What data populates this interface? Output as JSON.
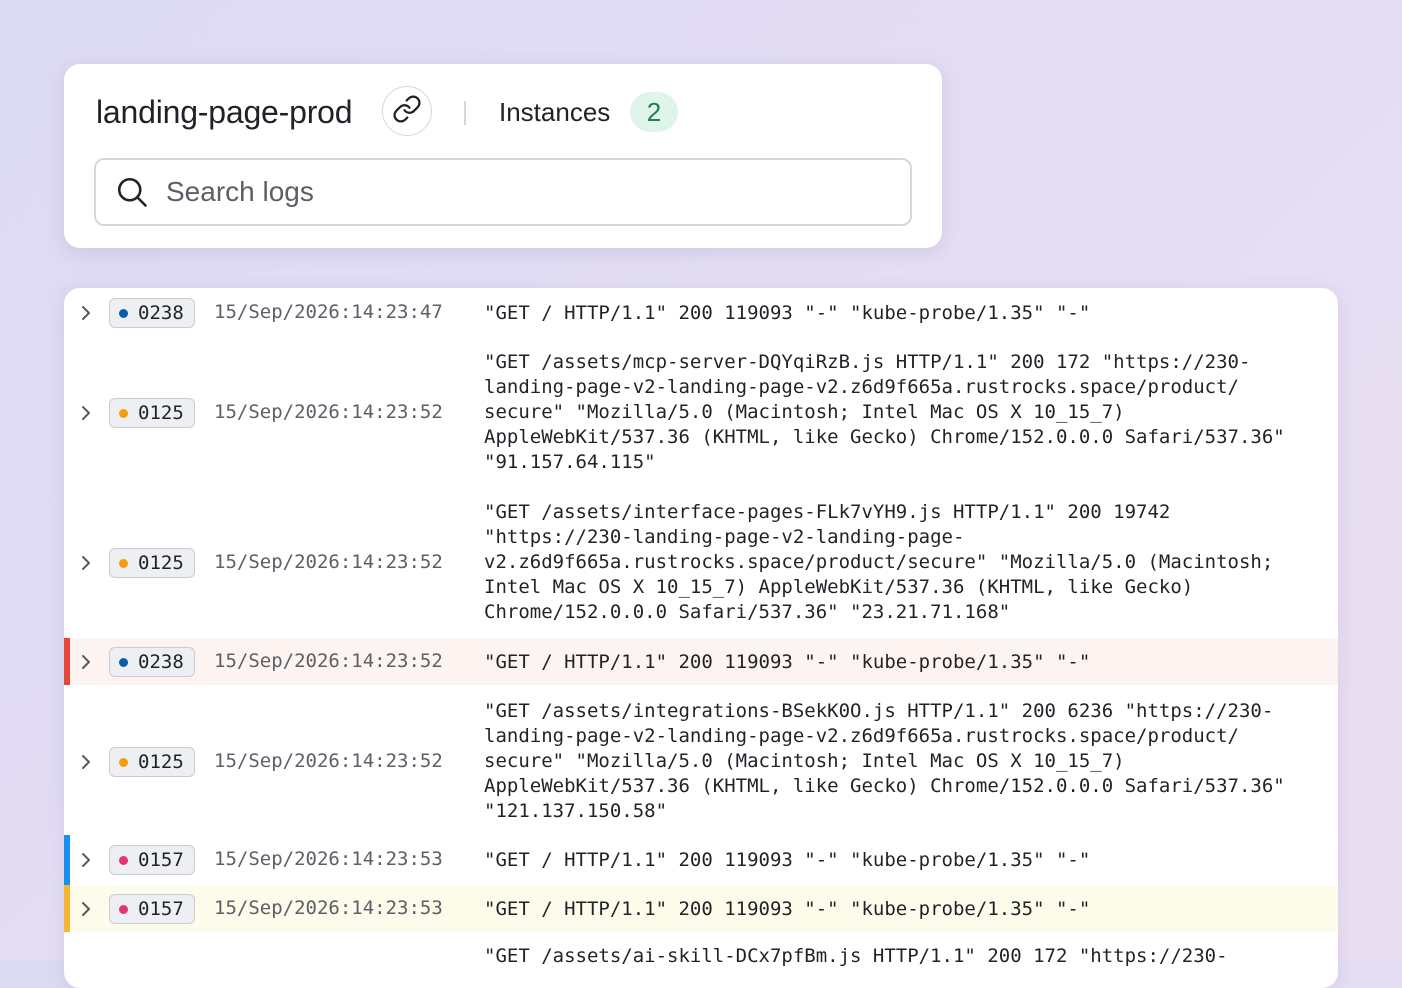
{
  "header": {
    "title": "landing-page-prod",
    "instances_label": "Instances",
    "instances_count": "2"
  },
  "search": {
    "placeholder": "Search logs",
    "value": ""
  },
  "colors": {
    "blue_instance": "#0b5cad",
    "orange_instance": "#f59e0b",
    "pink_instance": "#e0337a",
    "error_highlight_bg": "#fdf3f1",
    "error_line": "#e5483a",
    "info_line": "#1b8ff0",
    "warn_highlight_bg": "#fdfbea",
    "warn_line": "#f5b731"
  },
  "logs": [
    {
      "instance": "0238",
      "timestamp": "15/Sep/2026:14:23:47",
      "message": "\"GET / HTTP/1.1\" 200 119093 \"-\" \"kube-probe/1.35\" \"-\""
    },
    {
      "instance": "0125",
      "timestamp": "15/Sep/2026:14:23:52",
      "message": "\"GET /assets/mcp-server-DQYqiRzB.js HTTP/1.1\" 200 172 \"https://230-\nlanding-page-v2-landing-page-v2.z6d9f665a.rustrocks.space/product/\nsecure\" \"Mozilla/5.0 (Macintosh; Intel Mac OS X 10_15_7)\nAppleWebKit/537.36 (KHTML, like Gecko) Chrome/152.0.0.0 Safari/537.36\"\n\"91.157.64.115\""
    },
    {
      "instance": "0125",
      "timestamp": "15/Sep/2026:14:23:52",
      "message": "\"GET /assets/interface-pages-FLk7vYH9.js HTTP/1.1\" 200 19742\n\"https://230-landing-page-v2-landing-page-\nv2.z6d9f665a.rustrocks.space/product/secure\" \"Mozilla/5.0 (Macintosh;\nIntel Mac OS X 10_15_7) AppleWebKit/537.36 (KHTML, like Gecko)\nChrome/152.0.0.0 Safari/537.36\" \"23.21.71.168\""
    },
    {
      "instance": "0238",
      "timestamp": "15/Sep/2026:14:23:52",
      "message": "\"GET / HTTP/1.1\" 200 119093 \"-\" \"kube-probe/1.35\" \"-\""
    },
    {
      "instance": "0125",
      "timestamp": "15/Sep/2026:14:23:52",
      "message": "\"GET /assets/integrations-BSekK0O.js HTTP/1.1\" 200 6236 \"https://230-\nlanding-page-v2-landing-page-v2.z6d9f665a.rustrocks.space/product/\nsecure\" \"Mozilla/5.0 (Macintosh; Intel Mac OS X 10_15_7)\nAppleWebKit/537.36 (KHTML, like Gecko) Chrome/152.0.0.0 Safari/537.36\"\n\"121.137.150.58\""
    },
    {
      "instance": "0157",
      "timestamp": "15/Sep/2026:14:23:53",
      "message": "\"GET / HTTP/1.1\" 200 119093 \"-\" \"kube-probe/1.35\" \"-\""
    },
    {
      "instance": "0157",
      "timestamp": "15/Sep/2026:14:23:53",
      "message": "\"GET / HTTP/1.1\" 200 119093 \"-\" \"kube-probe/1.35\" \"-\""
    },
    {
      "instance": "",
      "timestamp": "",
      "message": "\"GET /assets/ai-skill-DCx7pfBm.js HTTP/1.1\" 200 172 \"https://230-"
    }
  ]
}
